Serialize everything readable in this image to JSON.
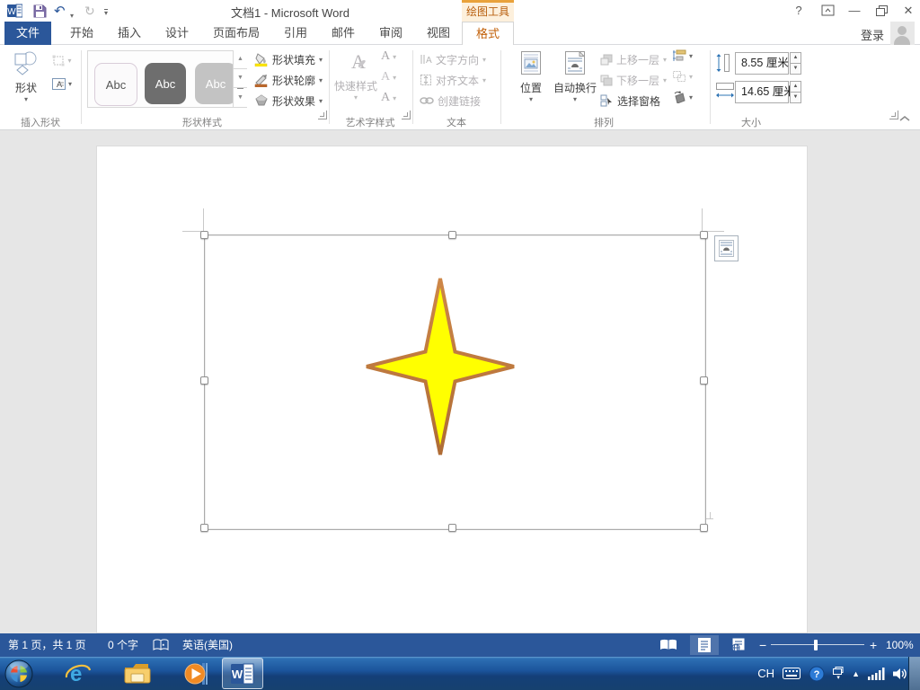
{
  "window": {
    "title": "文档1 - Microsoft Word",
    "contextual_tool_tab": "绘图工具",
    "sign_in_label": "登录"
  },
  "tabs": {
    "file": "文件",
    "items": [
      "开始",
      "插入",
      "设计",
      "页面布局",
      "引用",
      "邮件",
      "审阅",
      "视图"
    ],
    "contextual": "格式"
  },
  "ribbon": {
    "insert_shapes": {
      "label": "插入形状",
      "shapes_button": "形状"
    },
    "shape_styles": {
      "label": "形状样式",
      "gallery": [
        "Abc",
        "Abc",
        "Abc"
      ],
      "fill": "形状填充",
      "outline": "形状轮廓",
      "effects": "形状效果"
    },
    "wordart": {
      "label": "艺术字样式",
      "quick_styles": "快速样式"
    },
    "text": {
      "label": "文本",
      "direction": "文字方向",
      "align": "对齐文本",
      "link": "创建链接"
    },
    "arrange": {
      "label": "排列",
      "position": "位置",
      "wrap": "自动换行",
      "bring_forward": "上移一层",
      "send_backward": "下移一层",
      "selection_pane": "选择窗格"
    },
    "size": {
      "label": "大小",
      "height": "8.55",
      "width": "14.65",
      "unit": "厘米"
    }
  },
  "status": {
    "page_info": "第 1 页，共 1 页",
    "word_count": "0 个字",
    "language": "英语(美国)",
    "zoom_out": "−",
    "zoom_in": "+",
    "zoom_level": "100%"
  },
  "taskbar": {
    "ime_indicator": "CH"
  },
  "shape": {
    "type": "4-point-star",
    "fill_color": "#FFFF00",
    "outline_color_top": "#CE8748",
    "outline_color_bottom": "#AF6C35"
  },
  "icons": {
    "dropdown": "▾",
    "gallery_up": "▲",
    "gallery_down": "▼",
    "gallery_more": "▼",
    "undo": "↶",
    "redo": "↻",
    "spin_up": "▲",
    "spin_down": "▼",
    "help": "?",
    "minimize": "—",
    "close": "✕",
    "tray_expand": "▲",
    "lang_dd": "▾",
    "abc": "Abc"
  }
}
